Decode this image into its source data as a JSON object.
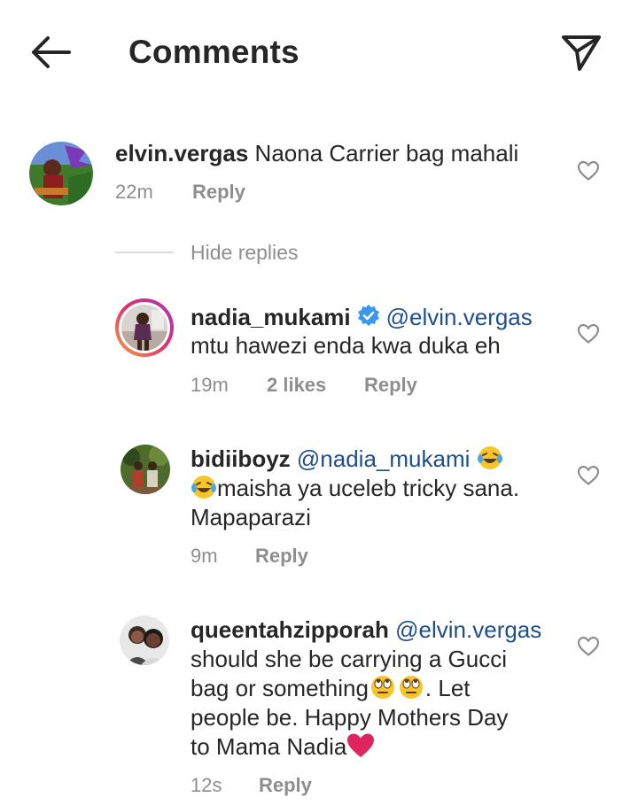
{
  "header": {
    "title": "Comments",
    "back_icon": "arrow-left-icon",
    "share_icon": "paper-plane-icon"
  },
  "colors": {
    "text": "#262626",
    "secondary": "#8e8e8e",
    "mention": "#1f4e8c",
    "verified": "#3897f0",
    "heart_emoji": "#e0245e"
  },
  "comments": [
    {
      "username": "elvin.vergas",
      "text": "Naona Carrier bag mahali",
      "time": "22m",
      "reply": "Reply"
    }
  ],
  "hide_replies": "Hide replies",
  "replies": [
    {
      "username": "nadia_mukami",
      "verified": true,
      "mention": "@elvin.vergas",
      "line2": "mtu hawezi enda kwa duka eh",
      "time": "19m",
      "likes": "2 likes",
      "reply": "Reply"
    },
    {
      "username": "bidiiboyz",
      "mention": "@nadia_mukami",
      "line2": "maisha ya uceleb tricky sana.",
      "line3": "Mapaparazi",
      "time": "9m",
      "reply": "Reply"
    },
    {
      "username": "queentahzipporah",
      "mention": "@elvin.vergas",
      "line2": "should she be carrying a Gucci",
      "line3a": "bag or something",
      "line3b": ". Let",
      "line4": "people be. Happy Mothers Day",
      "line5": "to Mama Nadia",
      "time": "12s",
      "reply": "Reply"
    }
  ]
}
